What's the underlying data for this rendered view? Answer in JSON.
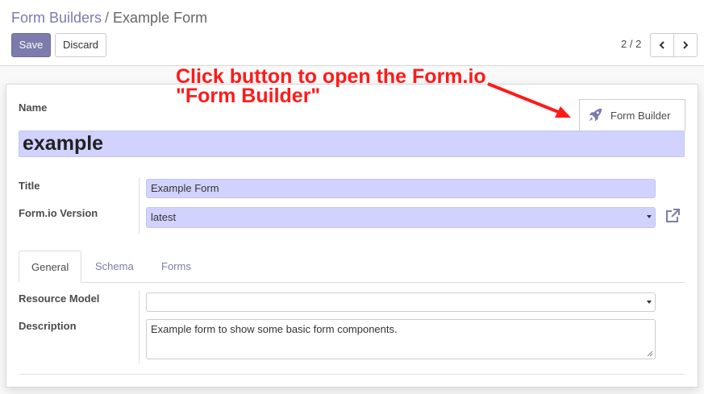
{
  "breadcrumb": {
    "parent": "Form Builders",
    "separator": "/",
    "current": "Example Form"
  },
  "toolbar": {
    "save_label": "Save",
    "discard_label": "Discard"
  },
  "pager": {
    "value": "2 / 2"
  },
  "annotation": {
    "line1": "Click button to open the Form.io",
    "line2": "\"Form Builder\"",
    "color": "#ff1a1a"
  },
  "form": {
    "name_label": "Name",
    "name_value": "example",
    "form_builder_button": "Form Builder",
    "title_label": "Title",
    "title_value": "Example Form",
    "version_label": "Form.io Version",
    "version_value": "latest"
  },
  "tabs": [
    {
      "label": "General",
      "active": true
    },
    {
      "label": "Schema",
      "active": false
    },
    {
      "label": "Forms",
      "active": false
    }
  ],
  "general": {
    "resource_model_label": "Resource Model",
    "resource_model_value": "",
    "description_label": "Description",
    "description_value": "Example form to show some basic form components."
  },
  "colors": {
    "accent": "#7c7bad",
    "required_field": "#d2d2ff"
  },
  "icons": {
    "prev": "chevron-left-icon",
    "next": "chevron-right-icon",
    "builder": "rocket-icon",
    "external": "external-link-icon"
  }
}
